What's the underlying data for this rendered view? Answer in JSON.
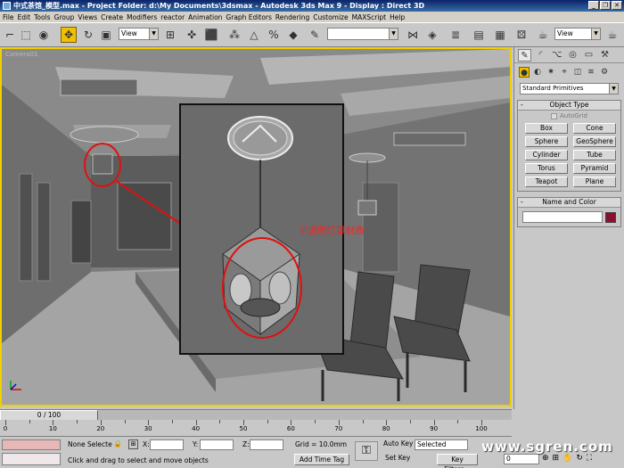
{
  "window": {
    "title": "中式茶馆_模型.max - Project Folder: d:\\My Documents\\3dsmax    - Autodesk 3ds Max 9    - Display : Direct 3D",
    "minimize": "_",
    "restore": "❐",
    "close": "✕"
  },
  "menu": [
    "File",
    "Edit",
    "Tools",
    "Group",
    "Views",
    "Create",
    "Modifiers",
    "reactor",
    "Animation",
    "Graph Editors",
    "Rendering",
    "Customize",
    "MAXScript",
    "Help"
  ],
  "toolbar": {
    "refcoord_view": "View",
    "named_selection": "",
    "viewport_dropdown": "View"
  },
  "viewport": {
    "label": "Camera01",
    "annotation": "半透明灯罩材质"
  },
  "command_panel": {
    "category": "Standard Primitives",
    "object_type_title": "Object Type",
    "autogrid": "AutoGrid",
    "primitives": [
      "Box",
      "Cone",
      "Sphere",
      "GeoSphere",
      "Cylinder",
      "Tube",
      "Torus",
      "Pyramid",
      "Teapot",
      "Plane"
    ],
    "name_color_title": "Name and Color",
    "object_color": "#8b1030"
  },
  "timeline": {
    "frame_display": "0 / 100",
    "ticks": [
      "0",
      "10",
      "20",
      "30",
      "40",
      "50",
      "60",
      "70",
      "80",
      "90",
      "100"
    ]
  },
  "status": {
    "selection": "None Selecte",
    "x_label": "X:",
    "y_label": "Y:",
    "z_label": "Z:",
    "grid": "Grid = 10.0mm",
    "prompt": "Click and drag to select and move objects",
    "add_time_tag": "Add Time Tag",
    "auto_key": "Auto Key",
    "set_key": "Set Key",
    "selected": "Selected",
    "key_filters": "Key Filters...",
    "current_frame": "0",
    "watermark": "www.sgren.com"
  }
}
